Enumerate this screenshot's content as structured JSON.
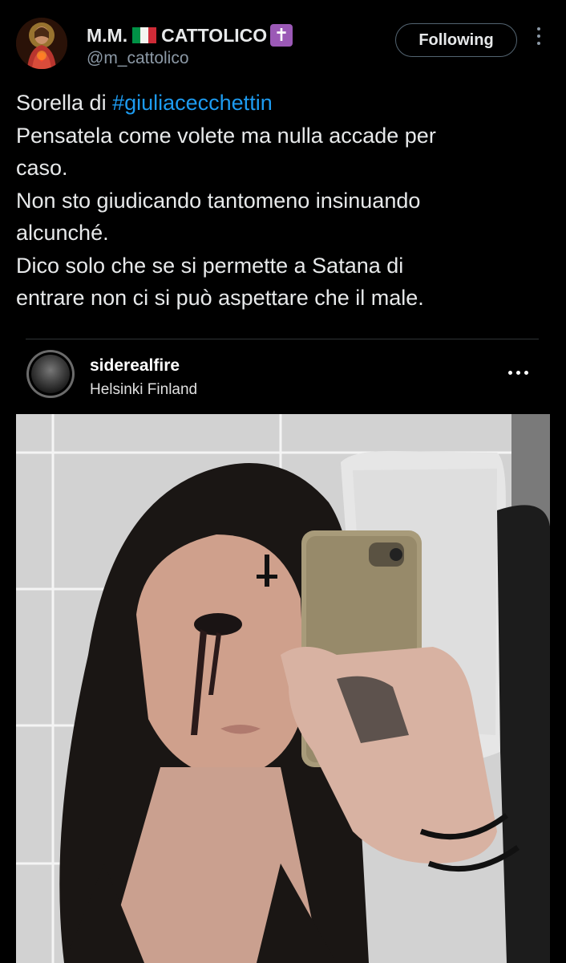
{
  "tweet": {
    "author_name": "M.M.",
    "author_name_suffix": "CATTOLICO",
    "flag_icon": "italy-flag-icon",
    "cross_icon": "latin-cross-icon",
    "handle": "@m_cattolico",
    "follow_label": "Following",
    "text": {
      "prefix": "Sorella di ",
      "hashtag": "#giuliacecchettin",
      "lines": [
        "Pensatela come volete ma nulla accade per",
        "caso.",
        "Non sto giudicando tantomeno insinuando",
        "alcunché.",
        "Dico solo che se si permette a Satana di",
        "entrare non ci si può aspettare che il male."
      ]
    },
    "colors": {
      "background": "#000000",
      "text": "#e7e9ea",
      "secondary_text": "#8b98a5",
      "hashtag": "#1d9bf0",
      "cross_badge": "#9b59b6"
    }
  },
  "embed": {
    "username": "siderealfire",
    "location": "Helsinki Finland",
    "more_icon": "more-horizontal-icon"
  }
}
